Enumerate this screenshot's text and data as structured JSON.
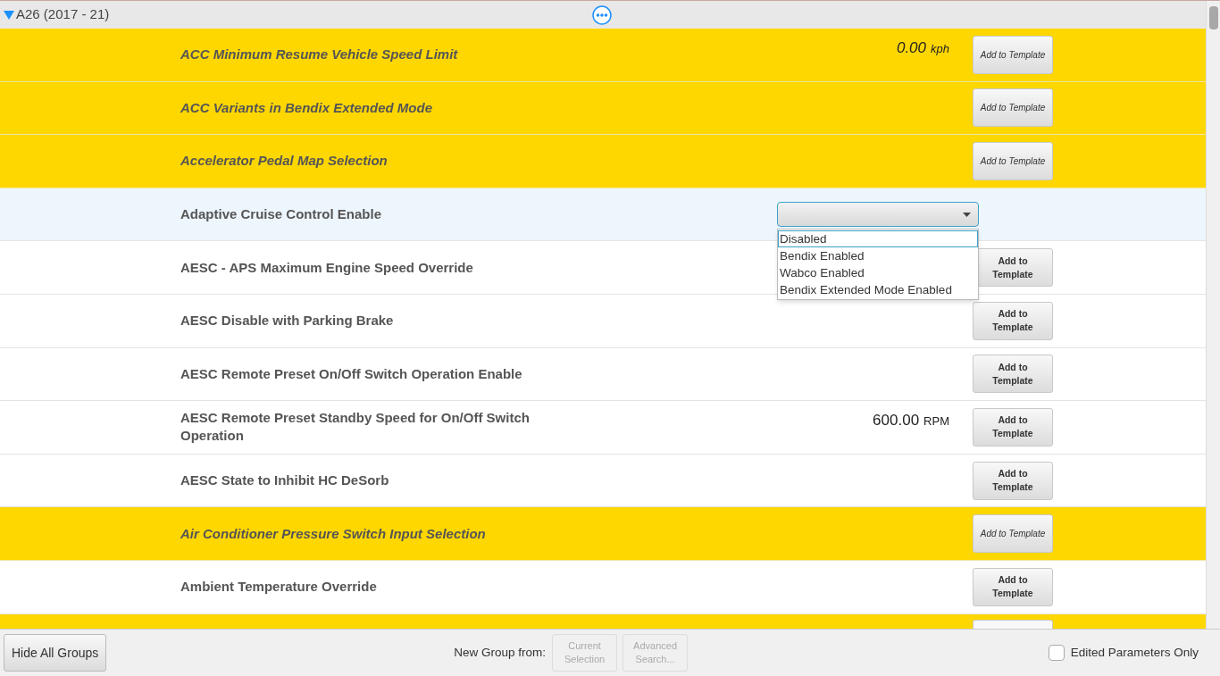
{
  "group": {
    "title": "A26 (2017 - 21)",
    "expanded": true
  },
  "rows": [
    {
      "kind": "highlighted",
      "name": "ACC Minimum Resume Vehicle Speed Limit",
      "value": "0.00",
      "unit": "kph",
      "button": "Add to Template",
      "selected": false
    },
    {
      "kind": "highlighted",
      "name": "ACC Variants in Bendix Extended Mode",
      "button": "Add to Template",
      "selected": false
    },
    {
      "kind": "highlighted",
      "name": "Accelerator Pedal Map Selection",
      "button": "Add to Template",
      "selected": false
    },
    {
      "kind": "normal",
      "name": "Adaptive Cruise Control Enable",
      "selected": true,
      "dropdown": {
        "expanded": true,
        "options": [
          {
            "label": "Disabled",
            "selected": true
          },
          {
            "label": "Bendix Enabled",
            "selected": false
          },
          {
            "label": "Wabco Enabled",
            "selected": false
          },
          {
            "label": "Bendix Extended Mode Enabled",
            "selected": false
          }
        ]
      }
    },
    {
      "kind": "normal",
      "name": "AESC - APS Maximum Engine Speed Override",
      "button": "Add to Template",
      "selected": false
    },
    {
      "kind": "normal",
      "name": "AESC Disable with Parking Brake",
      "button": "Add to Template",
      "selected": false
    },
    {
      "kind": "normal",
      "name": "AESC Remote Preset On/Off Switch Operation Enable",
      "button": "Add to Template",
      "selected": false
    },
    {
      "kind": "normal",
      "name": "AESC Remote Preset Standby Speed for On/Off Switch Operation",
      "value": "600.00",
      "unit": "RPM",
      "button": "Add to Template",
      "selected": false
    },
    {
      "kind": "normal",
      "name": "AESC State to Inhibit HC DeSorb",
      "button": "Add to Template",
      "selected": false
    },
    {
      "kind": "highlighted",
      "name": "Air Conditioner Pressure Switch Input Selection",
      "button": "Add to Template",
      "selected": false
    },
    {
      "kind": "normal",
      "name": "Ambient Temperature Override",
      "button": "Add to Template",
      "selected": false
    },
    {
      "kind": "highlighted",
      "selected": false
    }
  ],
  "footer": {
    "hide_button": "Hide All Groups",
    "new_group_label": "New Group from:",
    "buttons": [
      {
        "label": "Current Selection",
        "disabled": true
      },
      {
        "label": "Advanced Search...",
        "disabled": true
      }
    ],
    "edited_only": {
      "label": "Edited Parameters Only",
      "checked": false
    }
  }
}
